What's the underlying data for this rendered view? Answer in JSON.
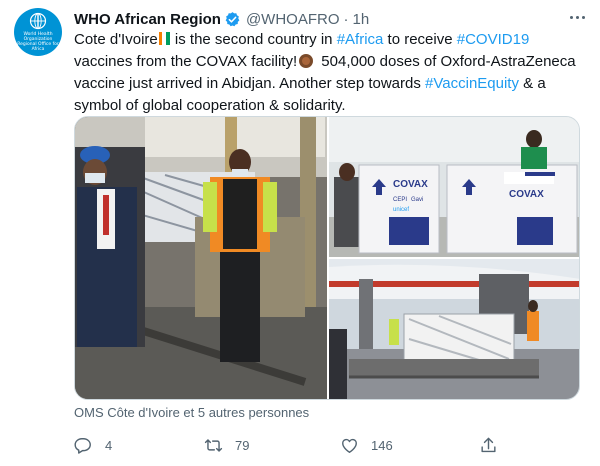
{
  "author": {
    "name": "WHO African Region",
    "handle": "@WHOAFRO",
    "separator": "·",
    "time": "1h",
    "avatar_text": "World Health Organization Regional Office for Africa",
    "brand_color": "#0093d5",
    "verified_color": "#1d9bf0"
  },
  "tweet": {
    "line1_a": "Cote d'Ivoire",
    "line1_b": " is the second country in ",
    "tag_africa": "#Africa",
    "line1_c": " to receive ",
    "tag_covid": "#COVID19",
    "line2_a": " vaccines from the COVAX facility!",
    "line2_b": " 504,000 doses of Oxford-AstraZeneca vaccine just arrived in Abidjan. Another step towards ",
    "tag_equity": "#VaccinEquity",
    "line3": " & a symbol of global cooperation & solidarity.",
    "link_color": "#1d9bf0"
  },
  "media": {
    "box_label": "COVAX",
    "box_sub1": "CEPI",
    "box_sub2": "Gavi",
    "box_sub3": "unicef"
  },
  "caption": "OMS Côte d'Ivoire et 5 autres personnes",
  "actions": {
    "reply_count": "4",
    "retweet_count": "79",
    "like_count": "146",
    "icons": [
      "reply-icon",
      "retweet-icon",
      "like-icon",
      "share-icon"
    ],
    "icon_color": "#536471"
  }
}
